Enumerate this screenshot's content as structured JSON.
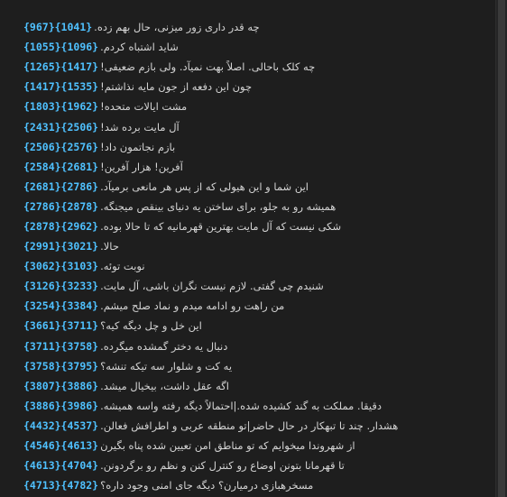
{
  "lines": [
    {
      "start": "{967}",
      "end": "{1041}",
      "text": ".چه قدر داری زور میزنی، حال بهم زده"
    },
    {
      "start": "{1055}",
      "end": "{1096}",
      "text": ".شاید اشتباه کردم"
    },
    {
      "start": "{1265}",
      "end": "{1417}",
      "text": "!چه کلک باحالی. اصلاً بهت نمیآد. ولی بازم ضعیفی"
    },
    {
      "start": "{1417}",
      "end": "{1535}",
      "text": "!چون این دفعه از جون مایه نذاشتم"
    },
    {
      "start": "{1803}",
      "end": "{1962}",
      "text": "!مشت ایالات متحده"
    },
    {
      "start": "{2431}",
      "end": "{2506}",
      "text": "!آل مایت برده شد"
    },
    {
      "start": "{2506}",
      "end": "{2576}",
      "text": "!بازم نجاتمون داد"
    },
    {
      "start": "{2584}",
      "end": "{2681}",
      "text": "!آفرین! هزار آفرین"
    },
    {
      "start": "{2681}",
      "end": "{2786}",
      "text": ".این شما و این هیولی که از پس هر مانعی برمیآد"
    },
    {
      "start": "{2786}",
      "end": "{2878}",
      "text": ".همیشه رو به جلو، برای ساختن یه دنیای بینقص میجنگه"
    },
    {
      "start": "{2878}",
      "end": "{2962}",
      "text": ".شکی نیست که آل مایت بهترین قهرمانیه که تا حالا بوده"
    },
    {
      "start": "{2991}",
      "end": "{3021}",
      "text": ".حالا"
    },
    {
      "start": "{3062}",
      "end": "{3103}",
      "text": ".نوبت توئه"
    },
    {
      "start": "{3126}",
      "end": "{3233}",
      "text": ".شنیدم چی گفتی. لازم نیست نگران باشی، آل مایت"
    },
    {
      "start": "{3254}",
      "end": "{3384}",
      "text": ".من راهت رو ادامه میدم و نماد صلح میشم"
    },
    {
      "start": "{3661}",
      "end": "{3711}",
      "text": "این خل و چل دیگه کیه؟"
    },
    {
      "start": "{3711}",
      "end": "{3758}",
      "text": ".دنبال یه دختر گمشده میگرده"
    },
    {
      "start": "{3758}",
      "end": "{3795}",
      "text": "یه کت و شلوار سه تیکه تنشه؟"
    },
    {
      "start": "{3807}",
      "end": "{3886}",
      "text": ".اگه عقل داشت، بیخیال میشد"
    },
    {
      "start": "{3886}",
      "end": "{3986}",
      "text": ".دقیقا. مملکت به گند کشیده شده.|احتمالاً دیگه رفته واسه همیشه"
    },
    {
      "start": "{4432}",
      "end": "{4537}",
      "text": ".هشدار. چند تا تبهکار در حال حاضر|تو منطقه عربی و اطرافش فعالن"
    },
    {
      "start": "{4546}",
      "end": "{4613}",
      "text": "از شهروندا میخوایم که تو مناطق امن تعیین شده پناه بگیرن"
    },
    {
      "start": "{4613}",
      "end": "{4704}",
      "text": ".تا قهرمانا بتونن اوضاع رو کنترل کنن و نظم رو برگردونن"
    },
    {
      "start": "{4713}",
      "end": "{4782}",
      "text": "مسخرهبازی درمیارن؟ دیگه جای امنی وجود داره؟"
    }
  ]
}
